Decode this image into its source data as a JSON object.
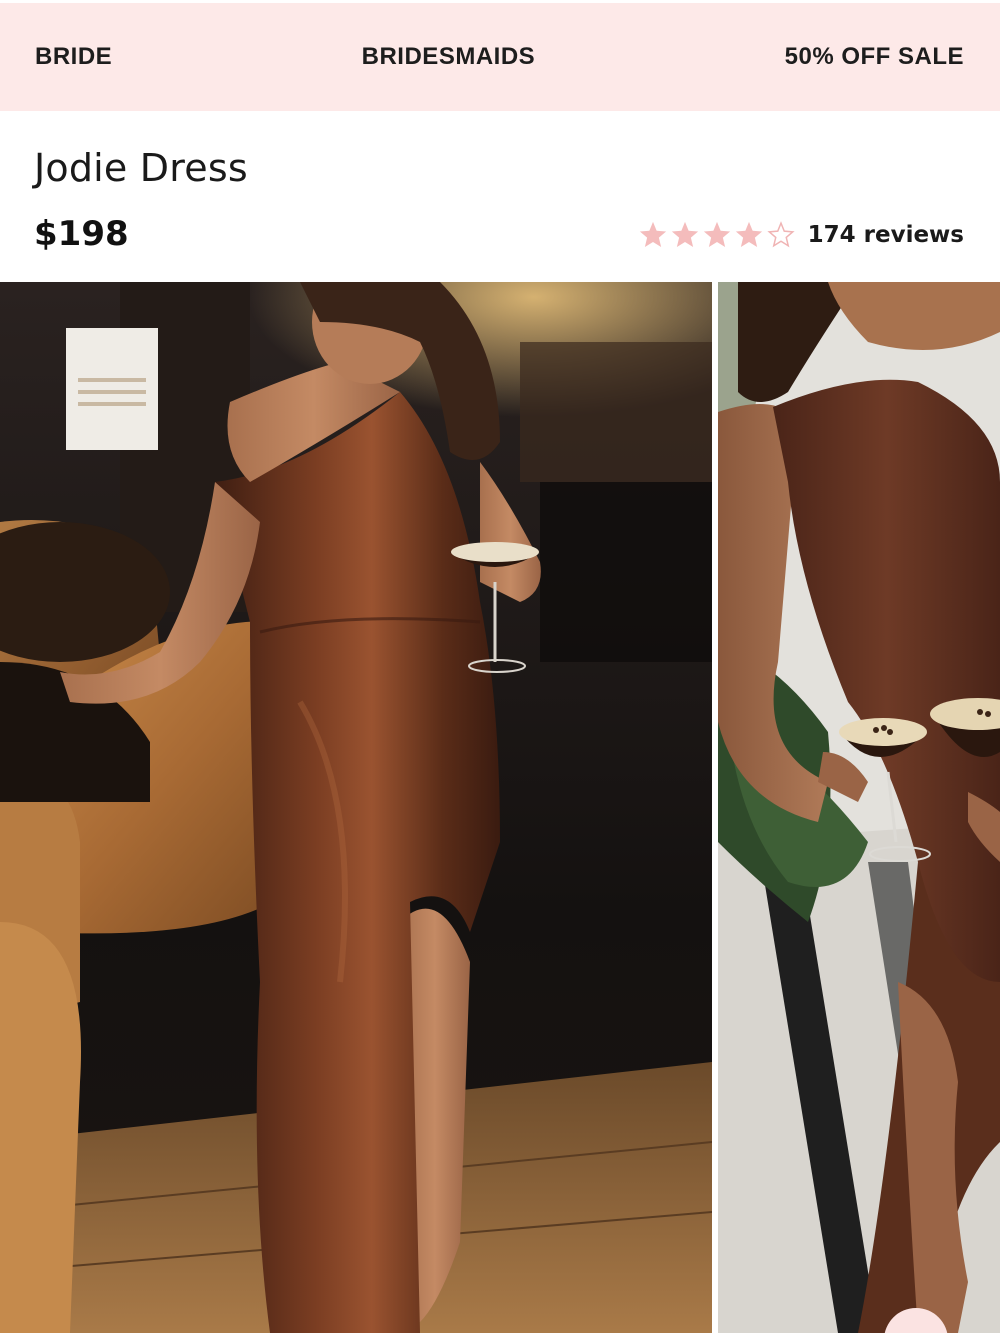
{
  "nav": {
    "items": [
      {
        "label": "BRIDE"
      },
      {
        "label": "BRIDESMAIDS"
      },
      {
        "label": "50% OFF SALE"
      }
    ],
    "background": "#fde9e8"
  },
  "product": {
    "title": "Jodie Dress",
    "price": "$198",
    "rating": {
      "value": 4,
      "max": 5,
      "reviews_label": "174 reviews",
      "star_color": "#f4bcbc"
    }
  },
  "gallery": {
    "images": [
      {
        "icon": "photo-brown-satin-one-shoulder-dress-bar"
      },
      {
        "icon": "photo-brown-satin-dress-espresso-martinis"
      }
    ],
    "dress_color": "#5a2e1c"
  }
}
